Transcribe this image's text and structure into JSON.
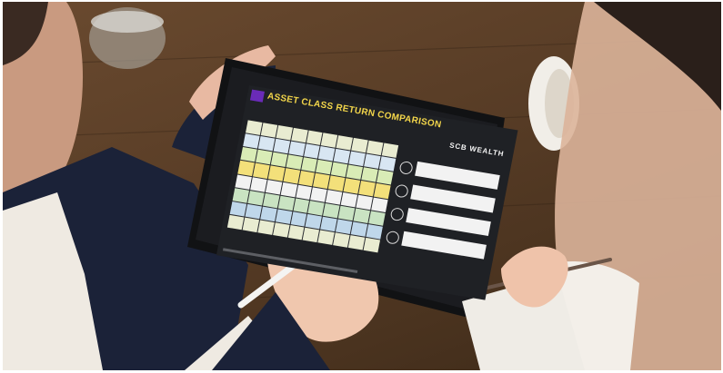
{
  "tablet_screen": {
    "title": "ASSET CLASS RETURN COMPARISON",
    "brand": "SCB WEALTH"
  },
  "colors": {
    "table": "#4a2e1b",
    "screen_bg": "#1f2125",
    "title_yellow": "#f2d54a",
    "logo_purple": "#6a2bb8",
    "jacket_navy": "#1b2238"
  },
  "grid_palette": [
    "#e9ecd1",
    "#c9e3c2",
    "#f3e07a",
    "#d8e6f2",
    "#bfd7ea",
    "#f2f2f2",
    "#d9ecb6"
  ]
}
